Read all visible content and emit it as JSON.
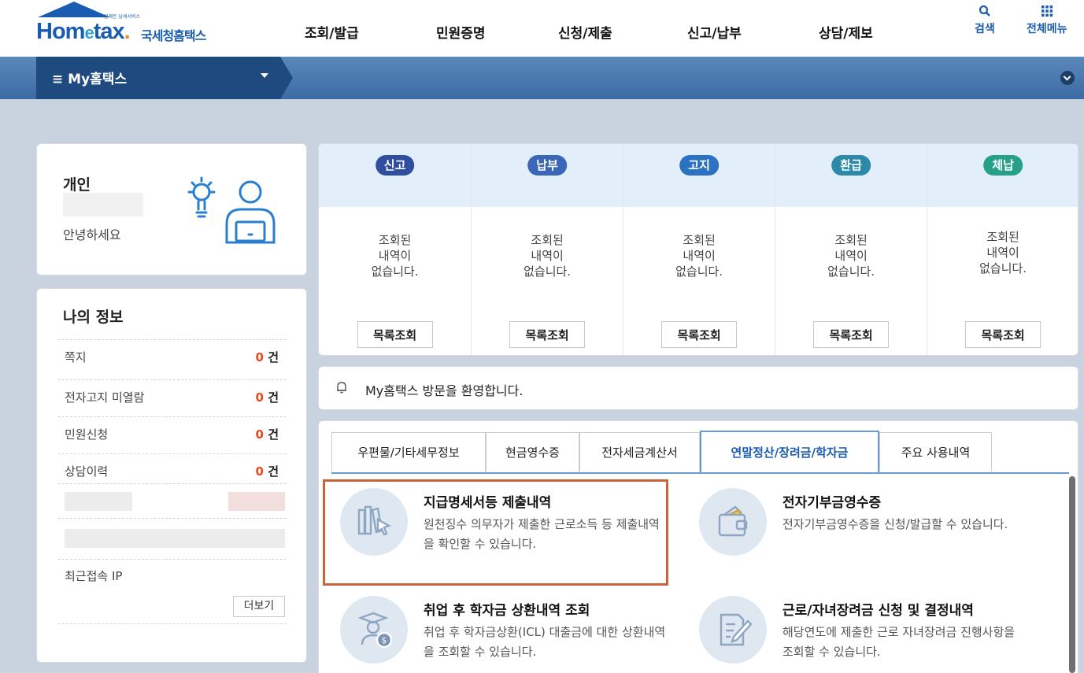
{
  "header": {
    "logo_small": "언제든 납세서비스",
    "logo_word_a": "Hom",
    "logo_word_e": "e",
    "logo_word_b": "tax",
    "logo_dot": ".",
    "logo_kr": "국세청홈택스",
    "nav": [
      "조회/발급",
      "민원증명",
      "신청/제출",
      "신고/납부",
      "상담/제보"
    ],
    "search_label": "검색",
    "menu_label": "전체메뉴"
  },
  "bar": {
    "title": "≡ My홈택스"
  },
  "profile": {
    "type": "개인",
    "greeting": "안녕하세요"
  },
  "my_info": {
    "title": "나의 정보",
    "rows": [
      {
        "label": "쪽지",
        "count": "0",
        "unit": " 건"
      },
      {
        "label": "전자고지 미열람",
        "count": "0",
        "unit": " 건"
      },
      {
        "label": "민원신청",
        "count": "0",
        "unit": " 건"
      },
      {
        "label": "상담이력",
        "count": "0",
        "unit": " 건"
      }
    ],
    "ip_label": "최근접속 IP",
    "more_label": "더보기"
  },
  "status": {
    "columns": [
      {
        "badge": "신고",
        "color": "#2f4f9e",
        "msg": [
          "조회된",
          "내역이",
          "없습니다."
        ],
        "btn": "목록조회"
      },
      {
        "badge": "납부",
        "color": "#3a67b8",
        "msg": [
          "조회된",
          "내역이",
          "없습니다."
        ],
        "btn": "목록조회"
      },
      {
        "badge": "고지",
        "color": "#2b73c2",
        "msg": [
          "조회된",
          "내역이",
          "없습니다."
        ],
        "btn": "목록조회"
      },
      {
        "badge": "환급",
        "color": "#2c8aa8",
        "msg": [
          "조회된",
          "내역이",
          "없습니다."
        ],
        "btn": "목록조회"
      },
      {
        "badge": "체납",
        "color": "#27a08a",
        "msg": [
          "조회된",
          "내역이",
          "없습니다."
        ],
        "btn": "목록조회"
      }
    ]
  },
  "welcome": "My홈택스 방문을 환영합니다.",
  "tabs": [
    "우편물/기타세무정보",
    "현금영수증",
    "전자세금계산서",
    "연말정산/장려금/학자금",
    "주요 사용내역"
  ],
  "services": [
    {
      "title": "지급명세서등 제출내역",
      "desc": "원천징수 의무자가 제출한 근로소득 등 제출내역을 확인할 수 있습니다.",
      "icon": "books-cursor-icon"
    },
    {
      "title": "전자기부금영수증",
      "desc": "전자기부금영수증을 신청/발급할 수 있습니다.",
      "icon": "wallet-icon"
    },
    {
      "title": "취업 후 학자금 상환내역 조회",
      "desc": "취업 후 학자금상환(ICL) 대출금에 대한 상환내역을 조회할 수 있습니다.",
      "icon": "graduate-coin-icon"
    },
    {
      "title": "근로/자녀장려금 신청 및 결정내역",
      "desc": "해당연도에 제출한 근로 자녀장려금 진행사항을 조회할 수 있습니다.",
      "icon": "document-pen-icon"
    }
  ],
  "colors": {
    "brand": "#1a5cb0",
    "count": "#e84a1e",
    "highlight": "#c8643a"
  }
}
